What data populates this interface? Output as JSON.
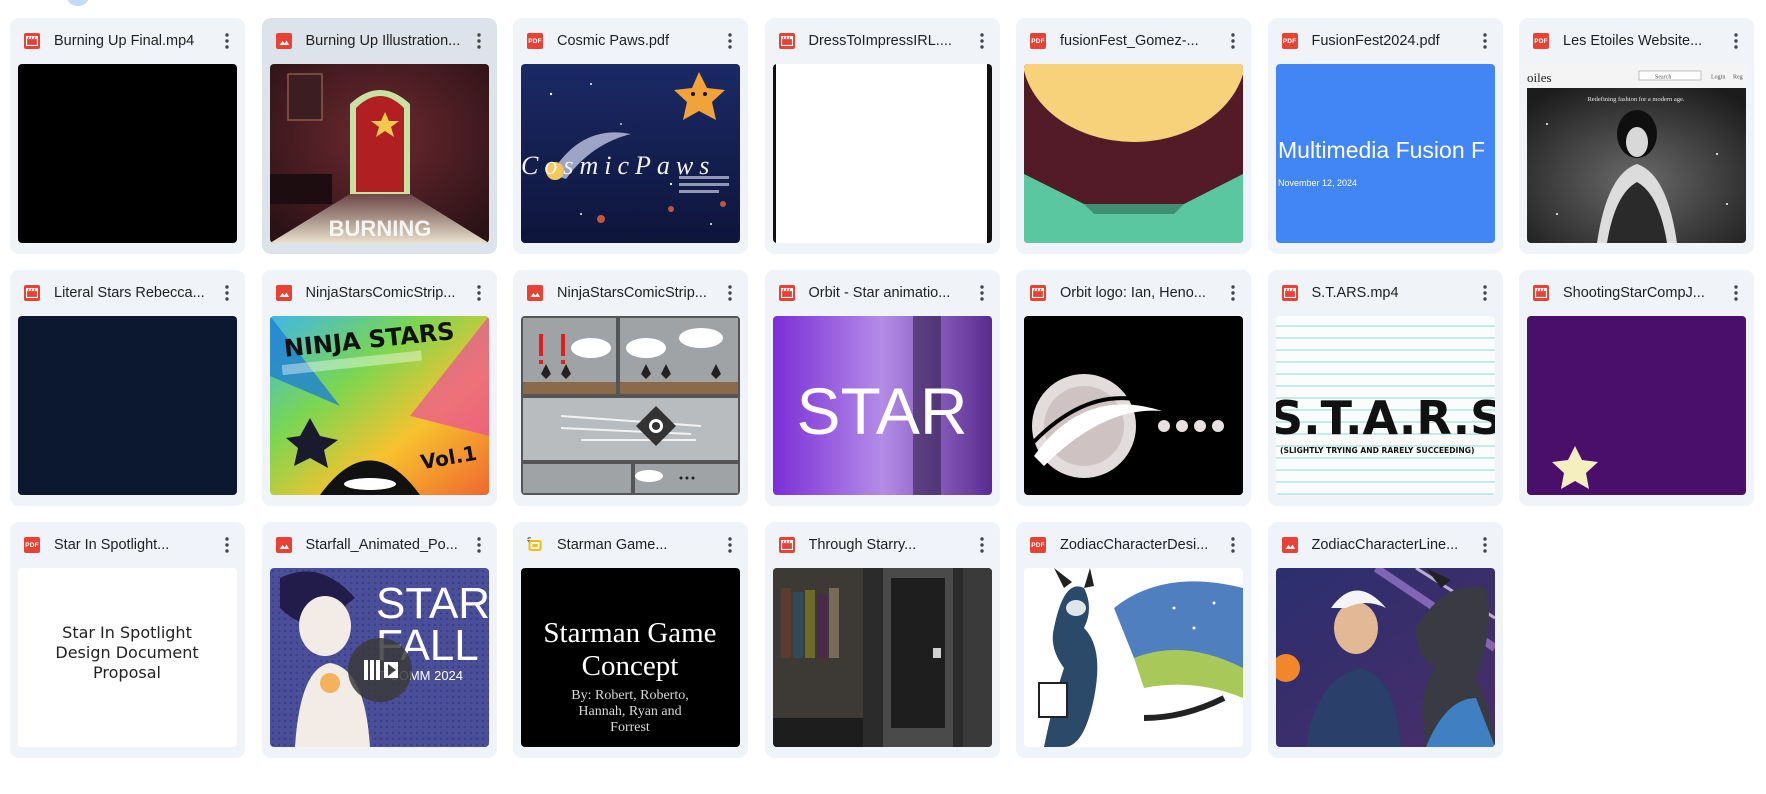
{
  "files": [
    {
      "name": "Burning Up Final.mp4",
      "type": "video",
      "icon": "video-file-icon",
      "thumb": "black"
    },
    {
      "name": "Burning Up Illustration...",
      "type": "image",
      "icon": "image-file-icon",
      "thumb": "burning-illustration",
      "thumb_text": "BURNING"
    },
    {
      "name": "Cosmic Paws.pdf",
      "type": "pdf",
      "icon": "pdf-file-icon",
      "thumb": "cosmic-paws",
      "thumb_text": "CosmicPaws"
    },
    {
      "name": "DressToImpressIRL....",
      "type": "video",
      "icon": "video-file-icon",
      "thumb": "white-doc"
    },
    {
      "name": "fusionFest_Gomez-...",
      "type": "pdf",
      "icon": "pdf-file-icon",
      "thumb": "fusionfest-gomez"
    },
    {
      "name": "FusionFest2024.pdf",
      "type": "pdf",
      "icon": "pdf-file-icon",
      "thumb": "fusionfest-2024",
      "thumb_title": "Multimedia Fusion F",
      "thumb_date": "November 12, 2024"
    },
    {
      "name": "Les Etoiles Website...",
      "type": "pdf",
      "icon": "pdf-file-icon",
      "thumb": "les-etoiles",
      "thumb_brand": "oiles",
      "thumb_search": "Search",
      "thumb_login": "Login",
      "thumb_reg": "Reg",
      "thumb_tagline": "Redefining fashion for a modern age."
    },
    {
      "name": "Literal Stars Rebecca...",
      "type": "video",
      "icon": "video-file-icon",
      "thumb": "navy"
    },
    {
      "name": "NinjaStarsComicStrip...",
      "type": "image",
      "icon": "image-file-icon",
      "thumb": "ninja-cover",
      "thumb_title": "NINJA STARS",
      "thumb_vol": "Vol.1"
    },
    {
      "name": "NinjaStarsComicStrip...",
      "type": "image",
      "icon": "image-file-icon",
      "thumb": "ninja-strip"
    },
    {
      "name": "Orbit - Star animatio...",
      "type": "video",
      "icon": "video-file-icon",
      "thumb": "orbit-star",
      "thumb_text": "STAR"
    },
    {
      "name": "Orbit logo: Ian, Heno...",
      "type": "video",
      "icon": "video-file-icon",
      "thumb": "orbit-logo"
    },
    {
      "name": "S.T.ARS.mp4",
      "type": "video",
      "icon": "video-file-icon",
      "thumb": "stars-text",
      "thumb_text": "S.T.A.R.S",
      "thumb_sub": "(SLIGHTLY TRYING AND RARELY SUCCEEDING)"
    },
    {
      "name": "ShootingStarCompJ...",
      "type": "video",
      "icon": "video-file-icon",
      "thumb": "shooting-star"
    },
    {
      "name": "Star In Spotlight...",
      "type": "pdf",
      "icon": "pdf-file-icon",
      "thumb": "spotlight",
      "thumb_lines": [
        "Star In Spotlight",
        "Design Document",
        "Proposal"
      ]
    },
    {
      "name": "Starfall_Animated_Po...",
      "type": "image",
      "icon": "image-file-icon",
      "thumb": "starfall",
      "thumb_title1": "STAR",
      "thumb_title2": "FALL",
      "thumb_sub": "T COMM 2024"
    },
    {
      "name": "Starman Game...",
      "type": "slides",
      "icon": "slides-file-icon",
      "thumb": "starman",
      "thumb_lines": [
        "Starman Game",
        "Concept"
      ],
      "thumb_by": [
        "By: Robert, Roberto,",
        "Hannah, Ryan and",
        "Forrest"
      ]
    },
    {
      "name": "Through Starry...",
      "type": "video",
      "icon": "video-file-icon",
      "thumb": "through-starry"
    },
    {
      "name": "ZodiacCharacterDesi...",
      "type": "pdf",
      "icon": "pdf-file-icon",
      "thumb": "zodiac-dragon"
    },
    {
      "name": "ZodiacCharacterLine...",
      "type": "image",
      "icon": "image-file-icon",
      "thumb": "zodiac-lineup"
    }
  ],
  "selected_index": 1,
  "colors": {
    "card": "#f0f4f9",
    "card_selected": "#dde3ea",
    "file_icon_red": "#e94235",
    "slides_yellow": "#fbbc04"
  }
}
